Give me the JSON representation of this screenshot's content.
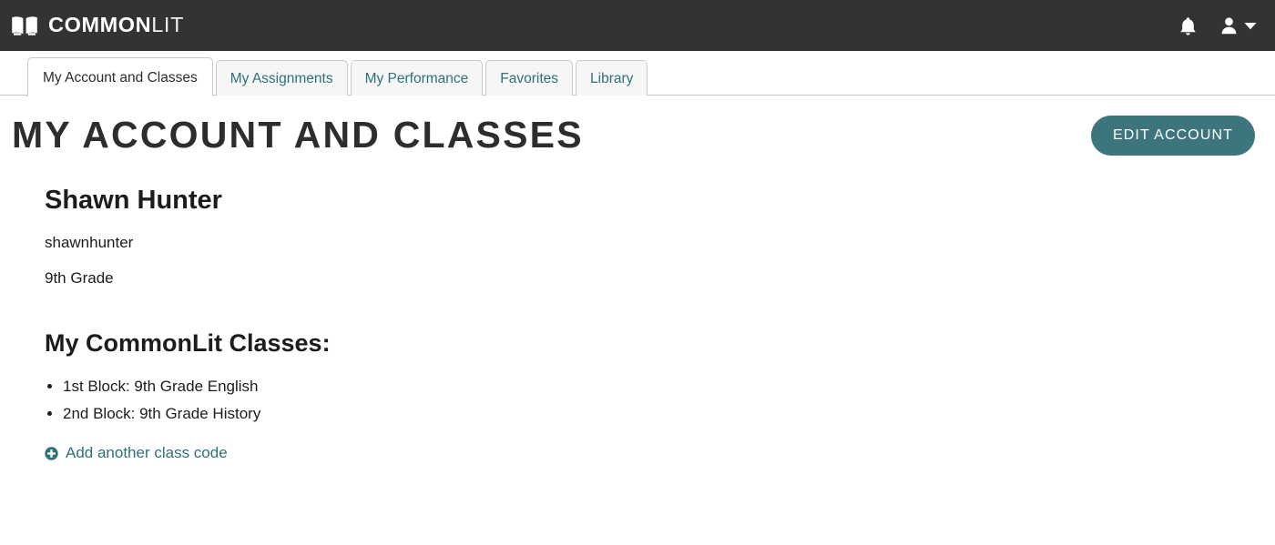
{
  "brand": {
    "name_bold": "COMMON",
    "name_light": "LIT",
    "logo_icon": "open-book-icon"
  },
  "topbar": {
    "background": "#333333",
    "notifications_icon": "bell-icon",
    "account_icon": "user-icon",
    "account_caret_icon": "chevron-down-icon"
  },
  "tabs": [
    {
      "label": "My Account and Classes",
      "active": true
    },
    {
      "label": "My Assignments",
      "active": false
    },
    {
      "label": "My Performance",
      "active": false
    },
    {
      "label": "Favorites",
      "active": false
    },
    {
      "label": "Library",
      "active": false
    }
  ],
  "page": {
    "title": "My Account and Classes",
    "edit_account_label": "Edit Account"
  },
  "profile": {
    "full_name": "Shawn Hunter",
    "username": "shawnhunter",
    "grade": "9th Grade"
  },
  "classes": {
    "heading": "My CommonLit Classes:",
    "items": [
      "1st Block: 9th Grade English",
      "2nd Block: 9th Grade History"
    ],
    "add_code_label": "Add another class code",
    "add_code_icon": "plus-circle-icon"
  },
  "colors": {
    "header_background": "#333333",
    "accent_teal": "#3d757d",
    "link_teal": "#2e7179",
    "text_dark": "#1c1c1c",
    "border_gray": "#c9c9c9",
    "tab_inactive_background": "#f6f6f6"
  }
}
